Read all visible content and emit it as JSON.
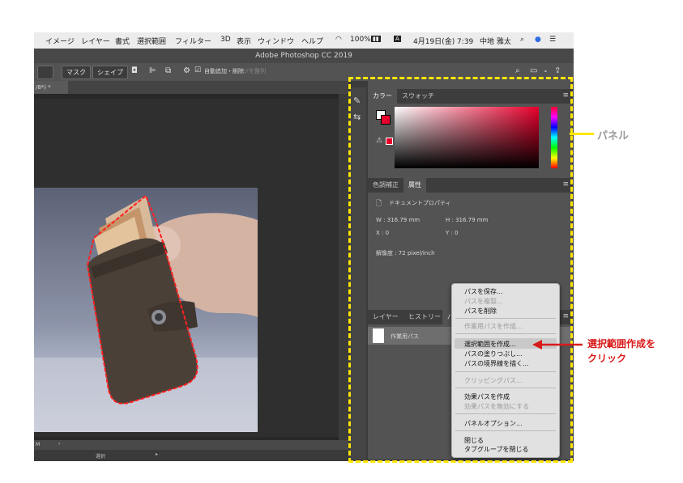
{
  "menubar": {
    "items": [
      "イメージ",
      "レイヤー",
      "書式",
      "選択範囲",
      "フィルター",
      "3D",
      "表示",
      "ウィンドウ",
      "ヘルプ"
    ],
    "battery": "100%",
    "date": "4月19日(金) 7:39",
    "user": "中地 雅太"
  },
  "app": {
    "title": "Adobe Photoshop CC 2019"
  },
  "options": {
    "mask_label": "マスク",
    "shape_label": "シェイプ",
    "auto_add_delete": "自動追加・削除",
    "align_edges": "エッジを整列"
  },
  "document": {
    "tab_label": "/8*) *",
    "timeline_label": "M",
    "status_label": "選択"
  },
  "color_panel": {
    "tab_color": "カラー",
    "tab_swatches": "スウォッチ"
  },
  "properties_panel": {
    "tab_adjust": "色調補正",
    "tab_properties": "属性",
    "doc_label": "ドキュメントプロパティ",
    "width": "W : 316.79 mm",
    "height": "H : 316.79 mm",
    "x": "X : 0",
    "y": "Y : 0",
    "resolution": "解像度 : 72 pixel/inch"
  },
  "layers_panel": {
    "tab_layers": "レイヤー",
    "tab_history": "ヒストリー",
    "tab_paths": "パ",
    "path_name": "作業用パス"
  },
  "context_menu": {
    "items": [
      {
        "label": "パスを保存...",
        "enabled": true
      },
      {
        "label": "パスを複製...",
        "enabled": false
      },
      {
        "label": "パスを削除",
        "enabled": true
      },
      {
        "label": "作業用パスを作成...",
        "enabled": false
      },
      {
        "label": "選択範囲を作成...",
        "enabled": true
      },
      {
        "label": "パスの塗りつぶし...",
        "enabled": true
      },
      {
        "label": "パスの境界線を描く...",
        "enabled": true
      },
      {
        "label": "クリッピングパス...",
        "enabled": false
      },
      {
        "label": "効果パスを作成",
        "enabled": true
      },
      {
        "label": "効果パスを無効にする",
        "enabled": false
      },
      {
        "label": "パネルオプション...",
        "enabled": true
      },
      {
        "label": "閉じる",
        "enabled": true
      },
      {
        "label": "タブグループを閉じる",
        "enabled": true
      }
    ]
  },
  "annotations": {
    "panel_label": "パネル",
    "click_line1": "選択範囲作成を",
    "click_line2": "クリック"
  },
  "colors": {
    "highlight_yellow": "#ffe600",
    "callout_red": "#d91a1a",
    "selection_red": "#ff2020"
  }
}
